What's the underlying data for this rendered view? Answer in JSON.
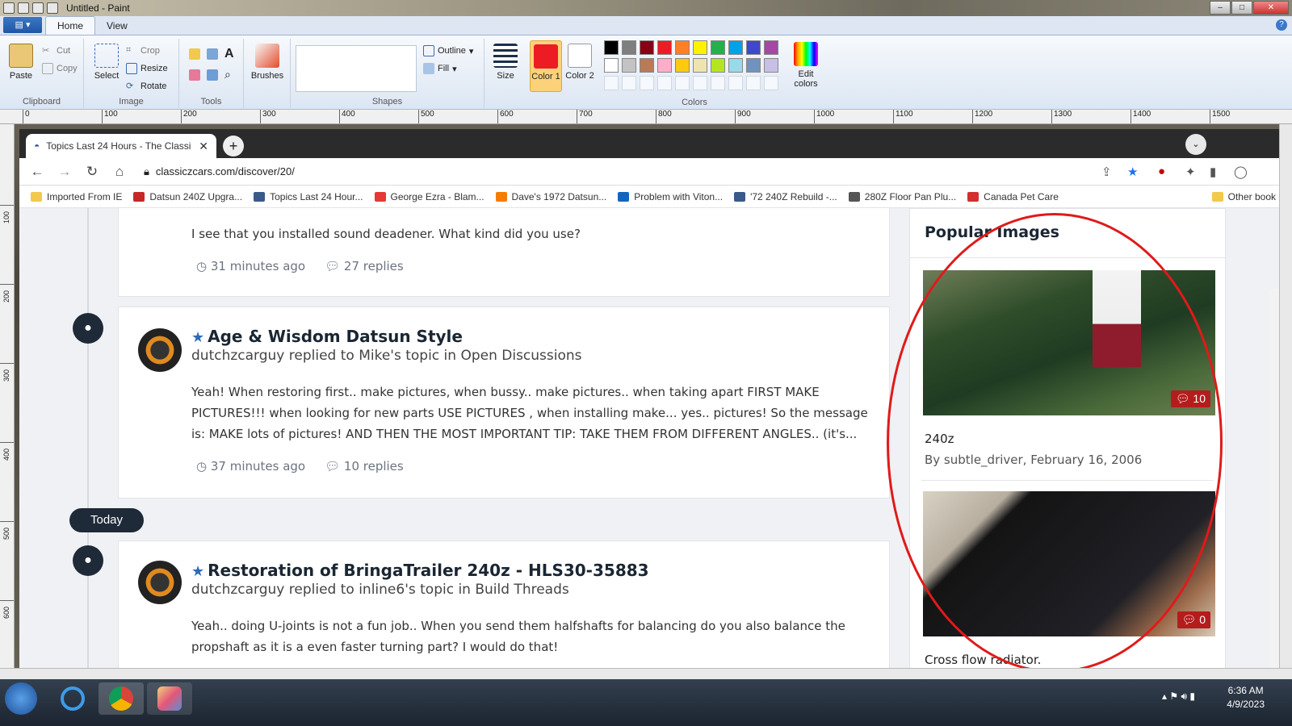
{
  "paint": {
    "title": "Untitled - Paint",
    "tabs": [
      "Home",
      "View"
    ],
    "clipboard": {
      "paste": "Paste",
      "cut": "Cut",
      "copy": "Copy",
      "label": "Clipboard"
    },
    "image": {
      "select": "Select",
      "crop": "Crop",
      "resize": "Resize",
      "rotate": "Rotate",
      "label": "Image"
    },
    "tools": {
      "label": "Tools"
    },
    "brushes": "Brushes",
    "shapes": {
      "outline": "Outline",
      "fill": "Fill",
      "label": "Shapes"
    },
    "size": "Size",
    "color1": "Color 1",
    "color2": "Color 2",
    "colors_label": "Colors",
    "edit_colors": "Edit colors",
    "ruler": [
      "0",
      "100",
      "200",
      "300",
      "400",
      "500",
      "600",
      "700",
      "800",
      "900",
      "1000",
      "1100",
      "1200",
      "1300",
      "1400",
      "1500"
    ],
    "vruler": [
      "100",
      "200",
      "300",
      "400",
      "500",
      "600"
    ],
    "palette": [
      "#000000",
      "#7f7f7f",
      "#880015",
      "#ed1c24",
      "#ff7f27",
      "#fff200",
      "#22b14c",
      "#00a2e8",
      "#3f48cc",
      "#a349a4",
      "#ffffff",
      "#c3c3c3",
      "#b97a57",
      "#ffaec9",
      "#ffc90e",
      "#efe4b0",
      "#b5e61d",
      "#99d9ea",
      "#7092be",
      "#c8bfe7"
    ]
  },
  "browser": {
    "tab_title": "Topics Last 24 Hours - The Classi",
    "url": "classiczcars.com/discover/20/",
    "bookmarks": [
      "Imported From IE",
      "Datsun 240Z Upgra...",
      "Topics Last 24 Hour...",
      "George Ezra - Blam...",
      "Dave's 1972 Datsun...",
      "Problem with Viton...",
      "'72 240Z Rebuild -...",
      "280Z Floor Pan Plu...",
      "Canada Pet Care",
      "Other book"
    ]
  },
  "feed": {
    "first": {
      "body": "I see that you installed sound deadener. What kind did you use?",
      "time": "31 minutes ago",
      "replies": "27 replies"
    },
    "second": {
      "title": "Age & Wisdom Datsun Style",
      "sub": "dutchzcarguy replied to Mike's topic in Open Discussions",
      "body": "Yeah! When restoring first.. make pictures, when bussy.. make pictures.. when taking apart FIRST MAKE PICTURES!!! when looking for new parts USE PICTURES , when installing make... yes.. pictures! So the message is: MAKE lots of pictures! AND THEN THE MOST IMPORTANT TIP: TAKE THEM FROM DIFFERENT ANGLES.. (it's...",
      "time": "37 minutes ago",
      "replies": "10 replies"
    },
    "today": "Today",
    "third": {
      "title": "Restoration of BringaTrailer 240z - HLS30-35883",
      "sub": "dutchzcarguy replied to inline6's topic in Build Threads",
      "body": "Yeah.. doing U-joints is not a fun job.. When you send them halfshafts for balancing do you also balance the propshaft as it is a even faster turning part? I would do that!"
    }
  },
  "sidebar": {
    "title": "Popular Images",
    "images": [
      {
        "badge": "10",
        "caption": "240z",
        "by": "By subtle_driver, February 16, 2006"
      },
      {
        "badge": "0",
        "caption": "Cross flow radiator."
      }
    ]
  },
  "taskbar": {
    "time": "6:36 AM",
    "date": "4/9/2023"
  }
}
